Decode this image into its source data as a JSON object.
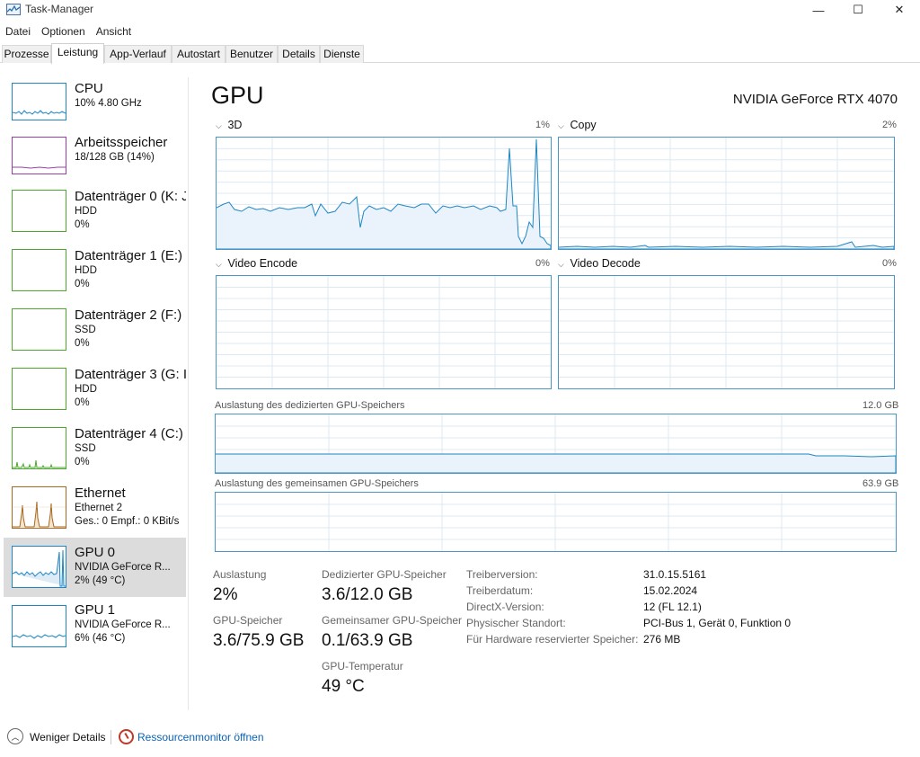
{
  "window": {
    "title": "Task-Manager",
    "icon": "task-manager-icon",
    "controls": {
      "minimize": "—",
      "maximize": "☐",
      "close": "✕"
    }
  },
  "menu": [
    "Datei",
    "Optionen",
    "Ansicht"
  ],
  "tabs": [
    {
      "label": "Prozesse",
      "active": false
    },
    {
      "label": "Leistung",
      "active": true
    },
    {
      "label": "App-Verlauf",
      "active": false
    },
    {
      "label": "Autostart",
      "active": false
    },
    {
      "label": "Benutzer",
      "active": false
    },
    {
      "label": "Details",
      "active": false
    },
    {
      "label": "Dienste",
      "active": false
    }
  ],
  "sidebar": {
    "items": [
      {
        "title": "CPU",
        "lines": [
          "10% 4.80 GHz"
        ],
        "color": "#1f86c2"
      },
      {
        "title": "Arbeitsspeicher",
        "lines": [
          "18/128 GB (14%)"
        ],
        "color": "#9b3fa8"
      },
      {
        "title": "Datenträger 0 (K: J",
        "lines": [
          "HDD",
          "0%"
        ],
        "color": "#4ea72e"
      },
      {
        "title": "Datenträger 1 (E:)",
        "lines": [
          "HDD",
          "0%"
        ],
        "color": "#4ea72e"
      },
      {
        "title": "Datenträger 2 (F:)",
        "lines": [
          "SSD",
          "0%"
        ],
        "color": "#4ea72e"
      },
      {
        "title": "Datenträger 3 (G: I",
        "lines": [
          "HDD",
          "0%"
        ],
        "color": "#4ea72e"
      },
      {
        "title": "Datenträger 4 (C:)",
        "lines": [
          "SSD",
          "0%"
        ],
        "color": "#4ea72e"
      },
      {
        "title": "Ethernet",
        "lines": [
          "Ethernet 2",
          "Ges.: 0 Empf.: 0 KBit/s"
        ],
        "color": "#a7671d"
      },
      {
        "title": "GPU 0",
        "lines": [
          "NVIDIA GeForce R...",
          "2% (49 °C)"
        ],
        "color": "#1f86c2",
        "selected": true
      },
      {
        "title": "GPU 1",
        "lines": [
          "NVIDIA GeForce R...",
          "6% (46 °C)"
        ],
        "color": "#1f86c2"
      }
    ]
  },
  "main": {
    "title": "GPU",
    "gpu_name": "NVIDIA GeForce RTX 4070",
    "engines": [
      {
        "label": "3D",
        "percent": "1%"
      },
      {
        "label": "Copy",
        "percent": "2%"
      },
      {
        "label": "Video Encode",
        "percent": "0%"
      },
      {
        "label": "Video Decode",
        "percent": "0%"
      }
    ],
    "dedicated_mem": {
      "label": "Auslastung des dedizierten GPU-Speichers",
      "max": "12.0 GB"
    },
    "shared_mem": {
      "label": "Auslastung des gemeinsamen GPU-Speichers",
      "max": "63.9 GB"
    },
    "graph_color": "#4b96c3"
  },
  "stats": {
    "utilization": {
      "label": "Auslastung",
      "value": "2%"
    },
    "gpu_memory": {
      "label": "GPU-Speicher",
      "value": "3.6/75.9 GB"
    },
    "dedicated": {
      "label": "Dedizierter GPU-Speicher",
      "value": "3.6/12.0 GB"
    },
    "shared": {
      "label": "Gemeinsamer GPU-Speicher",
      "value": "0.1/63.9 GB"
    },
    "temperature": {
      "label": "GPU-Temperatur",
      "value": "49 °C"
    }
  },
  "properties": [
    {
      "key": "Treiberversion:",
      "value": "31.0.15.5161"
    },
    {
      "key": "Treiberdatum:",
      "value": "15.02.2024"
    },
    {
      "key": "DirectX-Version:",
      "value": "12 (FL 12.1)"
    },
    {
      "key": "Physischer Standort:",
      "value": "PCI-Bus 1, Gerät 0, Funktion 0"
    },
    {
      "key": "Für Hardware reservierter Speicher:",
      "value": "276 MB"
    }
  ],
  "footer": {
    "fewer_details": "Weniger Details",
    "resource_monitor": "Ressourcenmonitor öffnen"
  }
}
